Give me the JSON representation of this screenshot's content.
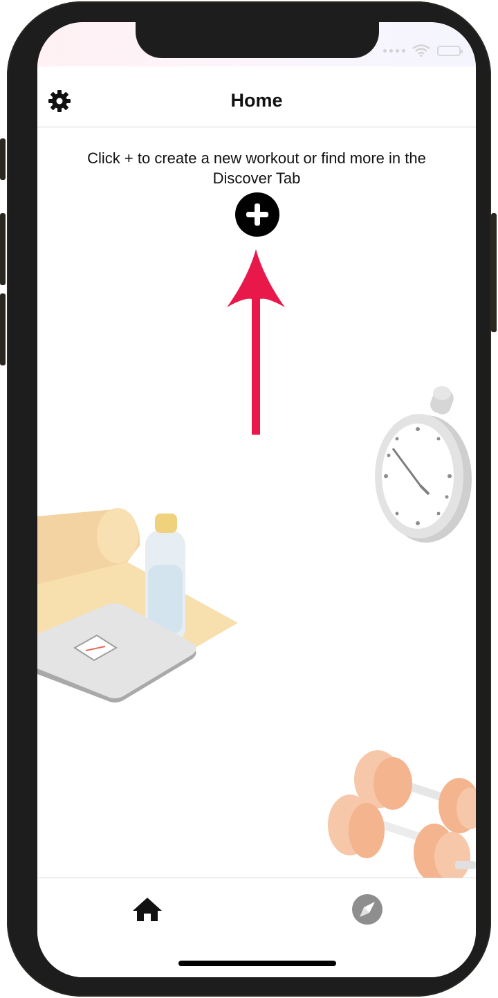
{
  "header": {
    "title": "Home"
  },
  "main": {
    "hint_text": "Click + to create a new workout or find more in the Discover Tab",
    "add_icon": "plus-icon",
    "arrow_color": "#e8194a"
  },
  "tabbar": {
    "tabs": [
      {
        "icon": "home-icon",
        "active": true
      },
      {
        "icon": "compass-icon",
        "active": false
      }
    ]
  },
  "colors": {
    "active_tab": "#111111",
    "inactive_tab": "#8e8e8e",
    "accent_arrow": "#e8194a"
  }
}
